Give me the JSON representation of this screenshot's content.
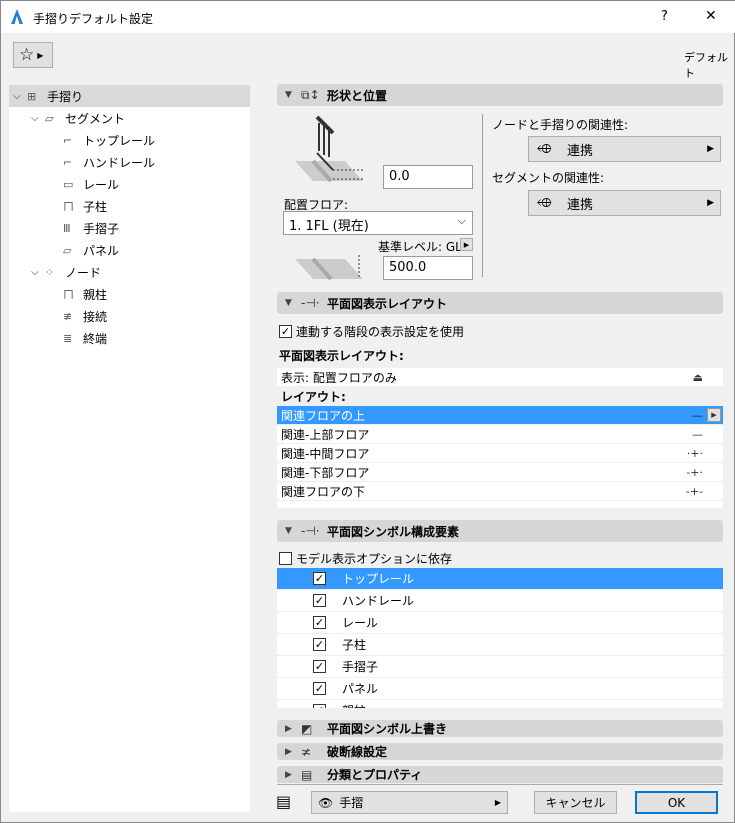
{
  "window": {
    "title": "手摺りデフォルト設定",
    "help": "?",
    "close": "✕"
  },
  "toolbar": {
    "favorites_icon": "star-icon",
    "default_label": "デフォルト"
  },
  "tree": [
    {
      "label": "手摺り",
      "level": 0,
      "expanded": true,
      "selected": true
    },
    {
      "label": "セグメント",
      "level": 1,
      "expanded": true
    },
    {
      "label": "トップレール",
      "level": 2
    },
    {
      "label": "ハンドレール",
      "level": 2
    },
    {
      "label": "レール",
      "level": 2
    },
    {
      "label": "子柱",
      "level": 2
    },
    {
      "label": "手摺子",
      "level": 2
    },
    {
      "label": "パネル",
      "level": 2
    },
    {
      "label": "ノード",
      "level": 1,
      "expanded": true
    },
    {
      "label": "親柱",
      "level": 2
    },
    {
      "label": "接続",
      "level": 2
    },
    {
      "label": "終端",
      "level": 2
    }
  ],
  "geometry": {
    "title": "形状と位置",
    "offset_value": "0.0",
    "home_floor_label": "配置フロア:",
    "home_floor_value": "1. 1FL (現在)",
    "ref_level_label": "基準レベル: GL",
    "height_value": "500.0",
    "node_assoc_label": "ノードと手摺りの関連性:",
    "node_assoc_value": "連携",
    "segment_assoc_label": "セグメントの関連性:",
    "segment_assoc_value": "連携"
  },
  "floorplan_layout": {
    "title": "平面図表示レイアウト",
    "use_stair_setting": "連動する階段の表示設定を使用",
    "use_stair_checked": true,
    "sub_label": "平面図表示レイアウト:",
    "display_row": "表示: 配置フロアのみ",
    "layout_label": "レイアウト:",
    "rows": [
      {
        "label": "関連フロアの上",
        "selected": true
      },
      {
        "label": "関連-上部フロア"
      },
      {
        "label": "関連-中間フロア"
      },
      {
        "label": "関連-下部フロア"
      },
      {
        "label": "関連フロアの下"
      }
    ]
  },
  "symbol_components": {
    "title": "平面図シンボル構成要素",
    "depend_model": "モデル表示オプションに依存",
    "depend_checked": false,
    "items": [
      {
        "label": "トップレール",
        "checked": true,
        "selected": true
      },
      {
        "label": "ハンドレール",
        "checked": true
      },
      {
        "label": "レール",
        "checked": true
      },
      {
        "label": "子柱",
        "checked": true
      },
      {
        "label": "手摺子",
        "checked": true
      },
      {
        "label": "パネル",
        "checked": true
      },
      {
        "label": "親柱",
        "checked": true
      }
    ]
  },
  "collapsed_sections": [
    {
      "title": "平面図シンボル上書き",
      "icon": "override-icon"
    },
    {
      "title": "破断線設定",
      "icon": "break-line-icon"
    },
    {
      "title": "分類とプロパティ",
      "icon": "document-icon"
    }
  ],
  "footer": {
    "layer_value": "手摺",
    "cancel": "キャンセル",
    "ok": "OK"
  },
  "colors": {
    "selection": "#3399ff",
    "header": "#d6d6d6",
    "ok_border": "#0078d7"
  }
}
